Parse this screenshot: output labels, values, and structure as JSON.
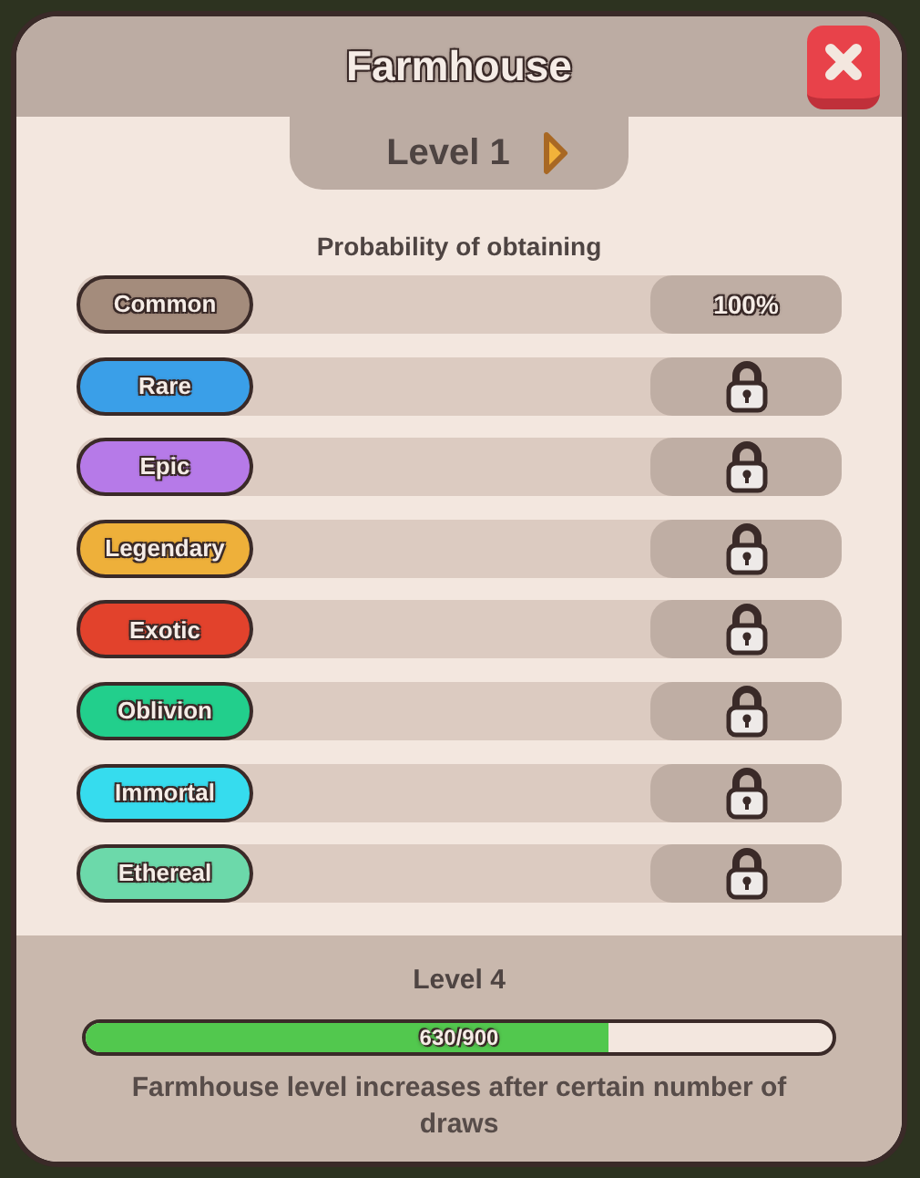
{
  "title": "Farmhouse",
  "level_tab": {
    "label": "Level 1"
  },
  "probability_label": "Probability of obtaining",
  "rarities": [
    {
      "name": "Common",
      "color": "#a48c7c",
      "locked": false,
      "value": "100%"
    },
    {
      "name": "Rare",
      "color": "#3a9fe8",
      "locked": true
    },
    {
      "name": "Epic",
      "color": "#b67ae8",
      "locked": true
    },
    {
      "name": "Legendary",
      "color": "#eeb03a",
      "locked": true
    },
    {
      "name": "Exotic",
      "color": "#e2422c",
      "locked": true
    },
    {
      "name": "Oblivion",
      "color": "#22cf8c",
      "locked": true
    },
    {
      "name": "Immortal",
      "color": "#36dcee",
      "locked": true
    },
    {
      "name": "Ethereal",
      "color": "#6cd9aa",
      "locked": true
    }
  ],
  "progress": {
    "label": "Level 4",
    "level": 0.7,
    "reading": "630/900"
  },
  "note": "Farmhouse level increases after certain number of draws"
}
